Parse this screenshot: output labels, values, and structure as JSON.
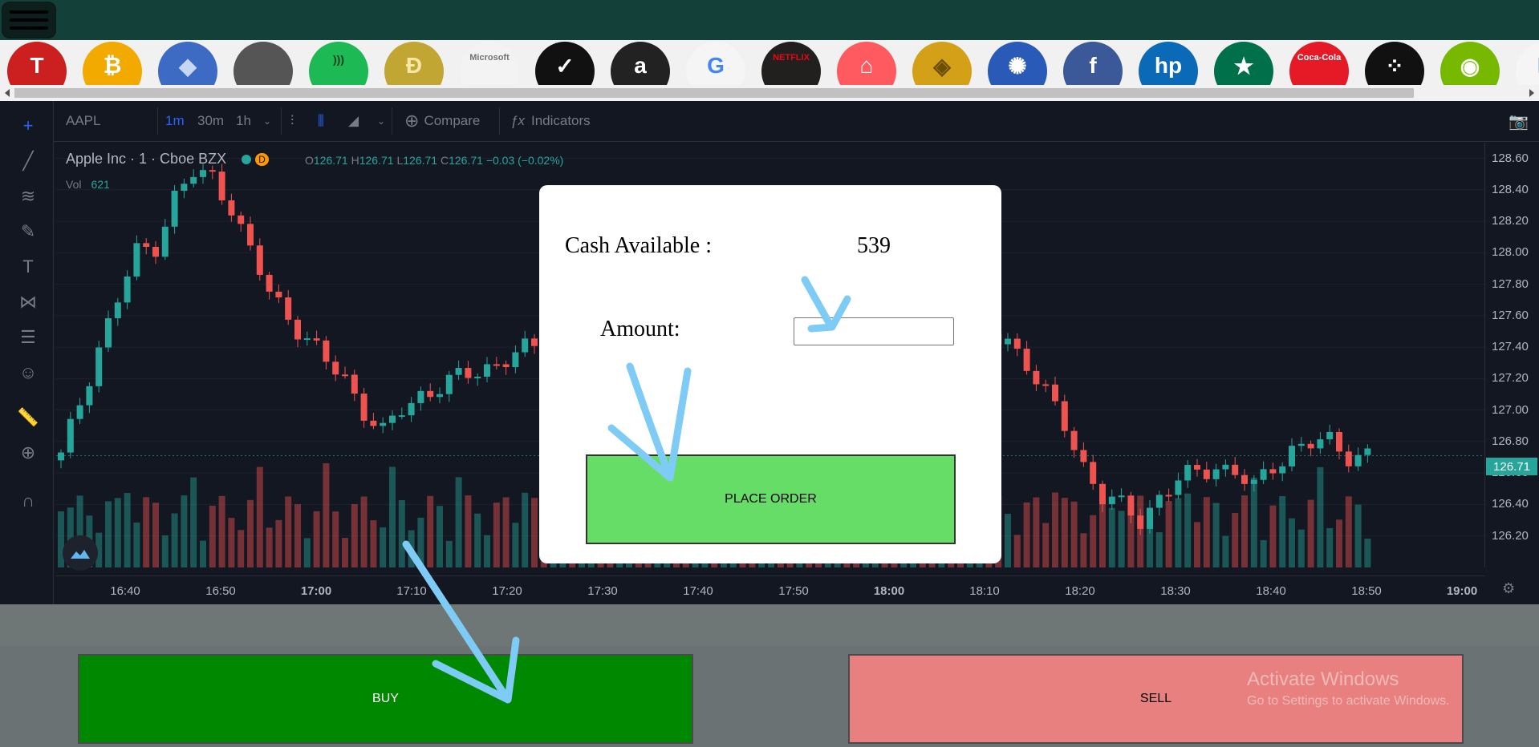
{
  "colors": {
    "topbar": "#14403a",
    "chart_bg": "#131722",
    "up_candle": "#26a69a",
    "down_candle": "#ef5350",
    "place_order_bg": "#66dd66",
    "buy_bg": "#008800",
    "sell_bg": "#e88080",
    "annotation_arrow": "#7ecbf5"
  },
  "logos": [
    {
      "name": "Tesla",
      "icon": "tesla-logo-icon",
      "bg": "#cc1f1f",
      "fg": "#ffffff",
      "mark": "T"
    },
    {
      "name": "Bitcoin",
      "icon": "bitcoin-logo-icon",
      "bg": "#f2a900",
      "fg": "#ffffff",
      "mark": "₿"
    },
    {
      "name": "Ethereum",
      "icon": "ethereum-logo-icon",
      "bg": "#3d6bc4",
      "fg": "#c8d6f5",
      "mark": "◆"
    },
    {
      "name": "Apple",
      "icon": "apple-logo-icon",
      "bg": "#555555",
      "fg": "#ffffff",
      "mark": ""
    },
    {
      "name": "Spotify",
      "icon": "spotify-logo-icon",
      "bg": "#1db954",
      "fg": "#0b3d1c",
      "mark": ")))"
    },
    {
      "name": "Dogecoin",
      "icon": "dogecoin-logo-icon",
      "bg": "#c2a633",
      "fg": "#f5e7a6",
      "mark": "Ð"
    },
    {
      "name": "Microsoft",
      "icon": "microsoft-logo-icon",
      "bg": "#f3f3f3",
      "fg": "#737373",
      "mark": "Microsoft"
    },
    {
      "name": "Nike",
      "icon": "nike-logo-icon",
      "bg": "#111111",
      "fg": "#ffffff",
      "mark": "✓"
    },
    {
      "name": "Amazon",
      "icon": "amazon-logo-icon",
      "bg": "#222222",
      "fg": "#ffffff",
      "mark": "a"
    },
    {
      "name": "Google",
      "icon": "google-logo-icon",
      "bg": "#f5f5f5",
      "fg": "#4285f4",
      "mark": "G"
    },
    {
      "name": "Netflix",
      "icon": "netflix-logo-icon",
      "bg": "#221f1f",
      "fg": "#e50914",
      "mark": "NETFLIX"
    },
    {
      "name": "Airbnb",
      "icon": "airbnb-logo-icon",
      "bg": "#ff5a5f",
      "fg": "#ffffff",
      "mark": "⌂"
    },
    {
      "name": "Binance",
      "icon": "binance-logo-icon",
      "bg": "#d4a017",
      "fg": "#6b4f00",
      "mark": "◈"
    },
    {
      "name": "Cardano",
      "icon": "cardano-logo-icon",
      "bg": "#2a5ab8",
      "fg": "#ffffff",
      "mark": "✺"
    },
    {
      "name": "Facebook",
      "icon": "facebook-logo-icon",
      "bg": "#3b5998",
      "fg": "#ffffff",
      "mark": "f"
    },
    {
      "name": "HP",
      "icon": "hp-logo-icon",
      "bg": "#0a6ab8",
      "fg": "#ffffff",
      "mark": "hp"
    },
    {
      "name": "Starbucks",
      "icon": "starbucks-logo-icon",
      "bg": "#00704a",
      "fg": "#ffffff",
      "mark": "★"
    },
    {
      "name": "Coca-Cola",
      "icon": "cocacola-logo-icon",
      "bg": "#e61a27",
      "fg": "#ffffff",
      "mark": "Coca-Cola"
    },
    {
      "name": "BlackBerry",
      "icon": "blackberry-logo-icon",
      "bg": "#111111",
      "fg": "#ffffff",
      "mark": "⁘"
    },
    {
      "name": "Nvidia",
      "icon": "nvidia-logo-icon",
      "bg": "#76b900",
      "fg": "#ffffff",
      "mark": "◉"
    },
    {
      "name": "Partial",
      "icon": "partial-logo-icon",
      "bg": "#f5f5f5",
      "fg": "#0a6ab8",
      "mark": "B"
    }
  ],
  "toolbar": {
    "symbol": "AAPL",
    "intervals": [
      "1m",
      "30m",
      "1h"
    ],
    "active_interval": "1m",
    "compare_label": "Compare",
    "indicators_label": "Indicators"
  },
  "legend": {
    "title": "Apple Inc · 1 · Cboe BZX",
    "badge": "D",
    "o_label": "O",
    "o_val": "126.71",
    "h_label": "H",
    "h_val": "126.71",
    "l_label": "L",
    "l_val": "126.71",
    "c_label": "C",
    "c_val": "126.71",
    "change": "−0.03 (−0.02%)",
    "vol_label": "Vol",
    "vol_val": "621"
  },
  "current_price_tag": "126.71",
  "chart_data": {
    "type": "candlestick",
    "symbol": "AAPL",
    "ylim": [
      126.05,
      128.7
    ],
    "y_ticks": [
      "128.60",
      "128.40",
      "128.20",
      "128.00",
      "127.80",
      "127.60",
      "127.40",
      "127.20",
      "127.00",
      "126.80",
      "126.60",
      "126.40",
      "126.20"
    ],
    "x_ticks": [
      "16:40",
      "16:50",
      "17:00",
      "17:10",
      "17:20",
      "17:30",
      "17:40",
      "17:50",
      "18:00",
      "18:10",
      "18:20",
      "18:30",
      "18:40",
      "18:50",
      "19:00"
    ],
    "bold_x_ticks": [
      "17:00",
      "18:00",
      "19:00"
    ],
    "close_series": [
      [
        0,
        126.7
      ],
      [
        2,
        127.05
      ],
      [
        4,
        127.4
      ],
      [
        6,
        127.7
      ],
      [
        8,
        128.0
      ],
      [
        10,
        128.05
      ],
      [
        12,
        128.35
      ],
      [
        14,
        128.5
      ],
      [
        16,
        128.48
      ],
      [
        18,
        128.3
      ],
      [
        20,
        128.0
      ],
      [
        22,
        127.75
      ],
      [
        24,
        127.6
      ],
      [
        26,
        127.45
      ],
      [
        28,
        127.3
      ],
      [
        30,
        127.2
      ],
      [
        32,
        127.0
      ],
      [
        34,
        126.85
      ],
      [
        36,
        127.0
      ],
      [
        38,
        127.1
      ],
      [
        40,
        127.15
      ],
      [
        42,
        127.2
      ],
      [
        44,
        127.25
      ],
      [
        46,
        127.3
      ],
      [
        48,
        127.35
      ],
      [
        50,
        127.4
      ],
      [
        52,
        127.45
      ],
      [
        54,
        127.5
      ],
      [
        56,
        127.6
      ],
      [
        58,
        127.65
      ],
      [
        60,
        127.62
      ],
      [
        100,
        127.45
      ],
      [
        102,
        127.3
      ],
      [
        104,
        127.1
      ],
      [
        106,
        126.9
      ],
      [
        108,
        126.65
      ],
      [
        110,
        126.45
      ],
      [
        112,
        126.38
      ],
      [
        114,
        126.3
      ],
      [
        116,
        126.45
      ],
      [
        118,
        126.55
      ],
      [
        120,
        126.6
      ],
      [
        122,
        126.65
      ],
      [
        124,
        126.6
      ],
      [
        126,
        126.5
      ],
      [
        128,
        126.65
      ],
      [
        130,
        126.75
      ],
      [
        132,
        126.78
      ],
      [
        134,
        126.8
      ],
      [
        136,
        126.72
      ],
      [
        138,
        126.71
      ]
    ],
    "volume_max": 130,
    "grid": true
  },
  "modal": {
    "cash_label": "Cash Available :",
    "cash_value": "539",
    "amount_label": "Amount:",
    "amount_value": "",
    "place_order_label": "PLACE ORDER"
  },
  "actions": {
    "buy_label": "BUY",
    "sell_label": "SELL"
  },
  "watermark": {
    "line1": "Activate Windows",
    "line2": "Go to Settings to activate Windows."
  }
}
